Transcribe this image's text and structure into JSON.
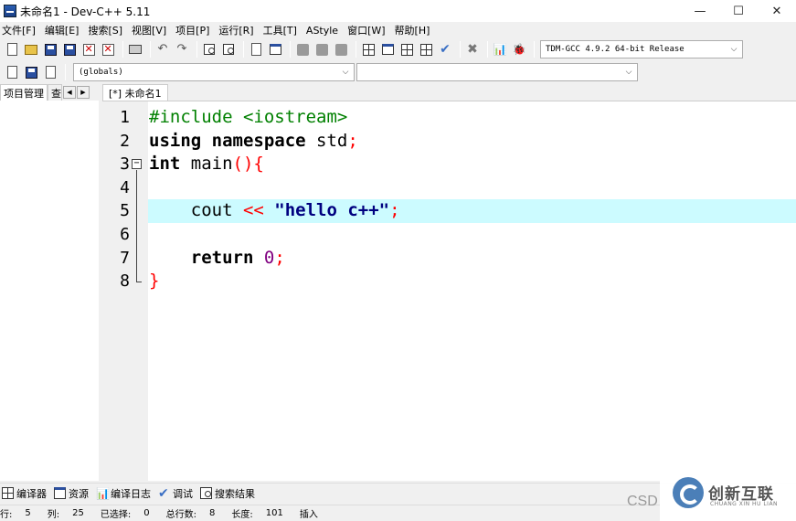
{
  "window": {
    "title": "未命名1 - Dev-C++ 5.11",
    "minimize": "—",
    "maximize": "☐",
    "close": "✕"
  },
  "menu": [
    "文件[F]",
    "编辑[E]",
    "搜索[S]",
    "视图[V]",
    "项目[P]",
    "运行[R]",
    "工具[T]",
    "AStyle",
    "窗口[W]",
    "帮助[H]"
  ],
  "toolbar": {
    "compiler": "TDM-GCC 4.9.2 64-bit Release",
    "scope": "(globals)",
    "function": "",
    "dropdown_arrow": "⌵"
  },
  "left_panel": {
    "tab_project": "项目管理",
    "tab_class": "查",
    "nav_prev": "◀",
    "nav_next": "▶"
  },
  "editor": {
    "tab": "[*] 未命名1",
    "line_numbers": [
      "1",
      "2",
      "3",
      "4",
      "5",
      "6",
      "7",
      "8"
    ],
    "active_line": 5,
    "lines": [
      [
        {
          "t": "pp",
          "v": "#include <iostream>"
        }
      ],
      [
        {
          "t": "kw",
          "v": "using"
        },
        {
          "t": "txt",
          "v": " "
        },
        {
          "t": "kw",
          "v": "namespace"
        },
        {
          "t": "txt",
          "v": " std"
        },
        {
          "t": "sym",
          "v": ";"
        }
      ],
      [
        {
          "t": "kw",
          "v": "int"
        },
        {
          "t": "txt",
          "v": " main"
        },
        {
          "t": "sym",
          "v": "(){"
        }
      ],
      [],
      [
        {
          "t": "txt",
          "v": "    cout "
        },
        {
          "t": "sym",
          "v": "<<"
        },
        {
          "t": "txt",
          "v": " "
        },
        {
          "t": "str",
          "v": "\"hello c++\""
        },
        {
          "t": "sym",
          "v": ";"
        }
      ],
      [],
      [
        {
          "t": "txt",
          "v": "    "
        },
        {
          "t": "kw",
          "v": "return"
        },
        {
          "t": "txt",
          "v": " "
        },
        {
          "t": "num",
          "v": "0"
        },
        {
          "t": "sym",
          "v": ";"
        }
      ],
      [
        {
          "t": "sym",
          "v": "}"
        }
      ]
    ],
    "colors": {
      "keyword": "#000000",
      "preprocessor": "#008000",
      "symbol": "#ff0000",
      "string": "#000080",
      "number": "#800080",
      "active_line_bg": "#ccfbff"
    }
  },
  "bottom_tabs": [
    {
      "icon": "compiler-icon",
      "label": "编译器"
    },
    {
      "icon": "resource-icon",
      "label": "资源"
    },
    {
      "icon": "compile-log-icon",
      "label": "编译日志"
    },
    {
      "icon": "debug-icon",
      "label": "调试"
    },
    {
      "icon": "search-results-icon",
      "label": "搜索结果"
    }
  ],
  "status": {
    "row_label": "行:",
    "row_value": "5",
    "col_label": "列:",
    "col_value": "25",
    "sel_label": "已选择:",
    "sel_value": "0",
    "total_label": "总行数:",
    "total_value": "8",
    "len_label": "长度:",
    "len_value": "101",
    "mode": "插入"
  },
  "watermark": {
    "csd": "CSD",
    "brand": "创新互联",
    "sub": "CHUANG XIN HU LIAN"
  }
}
